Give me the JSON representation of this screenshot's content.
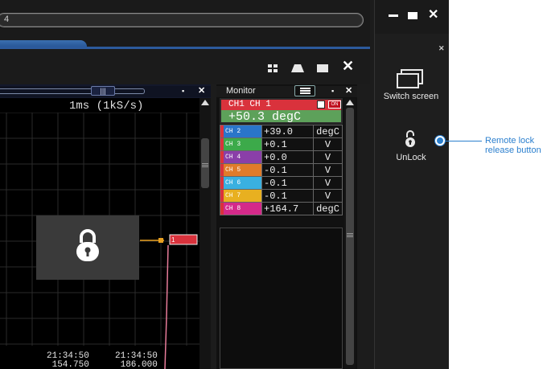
{
  "window": {
    "address_text": "4",
    "minimize_icon": "minimize-icon",
    "maximize_icon": "maximize-icon",
    "close_icon": "close-icon"
  },
  "toolbar": {
    "icons": [
      "grid-layout-icon",
      "waveform-view-icon",
      "single-window-icon",
      "close-icon"
    ]
  },
  "chart_panel": {
    "header_icon": "chart-settings-icon",
    "timebase": "1ms (1kS/s)",
    "lock_overlay_icon": "lock-icon",
    "trace_marker_label": "1",
    "timestamps": [
      {
        "time": "21:34:50",
        "ms": "154.750"
      },
      {
        "time": "21:34:50",
        "ms": "186.000"
      }
    ],
    "trace_color": "#d9323c",
    "marker_line_color": "#e8a020"
  },
  "monitor": {
    "title": "Monitor",
    "menu_icon": "hamburger-menu-icon",
    "ch1": {
      "name": "CH1 CH 1",
      "value": "+50.3 degC",
      "on_label": "ON",
      "color": "#d9323c",
      "value_bg": "#5da15a"
    },
    "channels": [
      {
        "label": "CH 2",
        "value": "+39.0",
        "unit": "degC",
        "color": "#2a75c9"
      },
      {
        "label": "CH 3",
        "value": "+0.1",
        "unit": "V",
        "color": "#3caa4a"
      },
      {
        "label": "CH 4",
        "value": "+0.0",
        "unit": "V",
        "color": "#8a3fa8"
      },
      {
        "label": "CH 5",
        "value": "-0.1",
        "unit": "V",
        "color": "#e07b2a"
      },
      {
        "label": "CH 6",
        "value": "-0.1",
        "unit": "V",
        "color": "#3ab0e0"
      },
      {
        "label": "CH 7",
        "value": "-0.1",
        "unit": "V",
        "color": "#e8b020"
      },
      {
        "label": "CH 8",
        "value": "+164.7",
        "unit": "degC",
        "color": "#d42a8a"
      }
    ]
  },
  "side_panel": {
    "switch_screen_label": "Switch screen",
    "switch_screen_icon": "switch-screen-icon",
    "unlock_label": "UnLock",
    "unlock_icon": "unlock-icon"
  },
  "callout": {
    "text_line1": "Remote lock",
    "text_line2": "release button",
    "color": "#2b7fce"
  }
}
